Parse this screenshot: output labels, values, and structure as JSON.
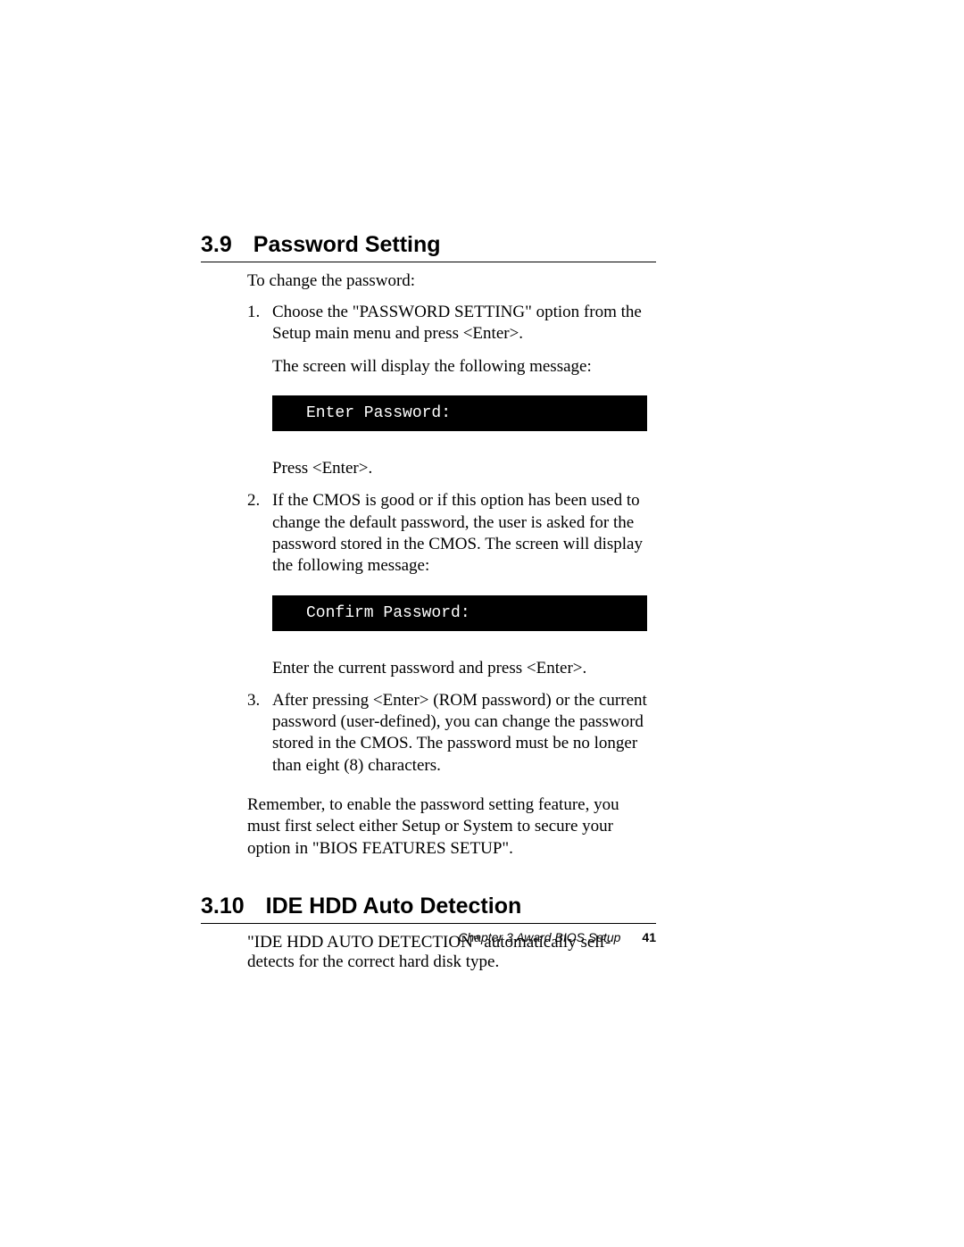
{
  "section1": {
    "number": "3.9",
    "title": "Password Setting",
    "intro": "To change the password:",
    "items": [
      {
        "num": "1.",
        "text": "Choose the  \"PASSWORD  SETTING\" option from the Setup main menu and press <Enter>.",
        "after1": "The screen will display the following message:",
        "terminal": "Enter Password:",
        "after2": "Press <Enter>."
      },
      {
        "num": "2.",
        "text": "If the CMOS is good or if this option has been used to change the default password, the user is asked for the password stored in the CMOS. The screen will display the following message:",
        "terminal": "Confirm Password:",
        "after2": "Enter the current password and press <Enter>."
      },
      {
        "num": "3.",
        "text": "After pressing <Enter> (ROM password) or the current password (user-defined), you can change the password stored in the CMOS. The password must be no longer than eight (8) characters."
      }
    ],
    "outro": "Remember, to enable the password setting feature, you must first select either Setup or System to secure your option in \"BIOS FEA­TURES SETUP\"."
  },
  "section2": {
    "number": "3.10",
    "title": "IDE HDD Auto Detection",
    "intro": "\"IDE HDD AUTO DETECTION\" automatically self-detects for the correct hard disk type."
  },
  "footer": {
    "chapter": "Chapter 3  Award BIOS Setup",
    "page": "41"
  }
}
